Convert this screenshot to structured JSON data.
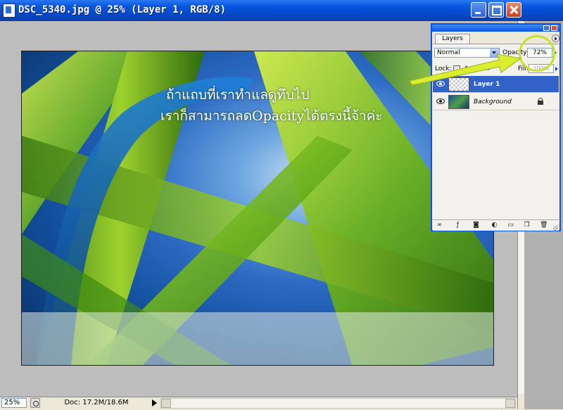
{
  "window": {
    "title": "DSC_5340.jpg @ 25% (Layer 1, RGB/8)",
    "minimize_icon": "minimize-icon",
    "maximize_icon": "maximize-icon",
    "close_icon": "close-icon"
  },
  "canvas": {
    "overlay_line1": "ถ้าแถบที่เราทำแลดูทึบไป",
    "overlay_line2": "เราก็สามารถลดOpacityได้ตรงนี้จ้าค่ะ"
  },
  "statusbar": {
    "zoom": "25%",
    "doc_info": "Doc: 17.2M/18.6M"
  },
  "layers_panel": {
    "tab_label": "Layers",
    "blend_mode": "Normal",
    "opacity_label": "Opacity:",
    "opacity_value": "72%",
    "lock_label": "Lock:",
    "fill_label": "Fill:",
    "fill_value": "100%",
    "layers": [
      {
        "name": "Layer 1",
        "selected": true,
        "visible": true
      },
      {
        "name": "Background",
        "selected": false,
        "visible": true,
        "locked": true
      }
    ],
    "footer_buttons": [
      "link-icon",
      "layer-style-icon",
      "mask-icon",
      "adjustment-icon",
      "group-icon",
      "new-layer-icon",
      "trash-icon"
    ]
  },
  "colors": {
    "title_bar": "#0a55e0",
    "selected_layer": "#3162c8",
    "annotation": "#c9e02a"
  }
}
